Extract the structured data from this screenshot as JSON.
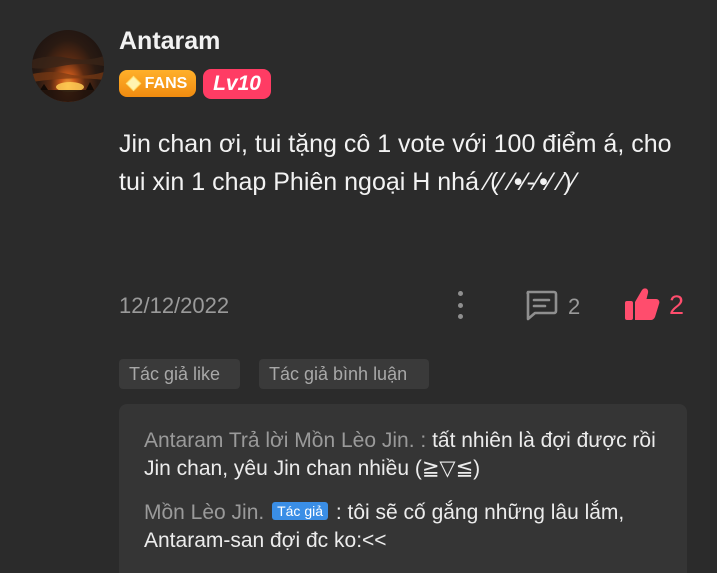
{
  "user": {
    "name": "Antaram",
    "fans_badge": "FANS",
    "level_badge": "Lv10"
  },
  "comment": {
    "text": "Jin chan ơi, tui tặng cô 1 vote với 100 điểm á, cho tui xin 1 chap Phiên ngoại H nhá ⁄(⁄ ⁄•⁄-⁄•⁄ ⁄)⁄",
    "date": "12/12/2022",
    "reply_count": "2",
    "like_count": "2"
  },
  "tags": {
    "author_liked": "Tác giả like",
    "author_replied": "Tác giả bình luận"
  },
  "replies": [
    {
      "name": "Antaram Trả lời Mồn Lèo Jin. :",
      "text": "tất nhiên là đợi được rồi Jin chan, yêu Jin chan nhiều (≧▽≦)"
    },
    {
      "name": "Mồn Lèo Jin.",
      "badge": "Tác giả",
      "text": ": tôi sẽ cố gắng những lâu lắm, Antaram-san đợi đc ko:<<"
    }
  ],
  "colors": {
    "background": "#2b2b2b",
    "like_accent": "#ff4d6d",
    "fans_badge": "#f5961a",
    "level_badge": "#ff3c64",
    "author_badge": "#3a8ee6"
  },
  "icons": {
    "more": "more-vertical-icon",
    "comment": "comment-icon",
    "like": "thumbs-up-icon"
  }
}
